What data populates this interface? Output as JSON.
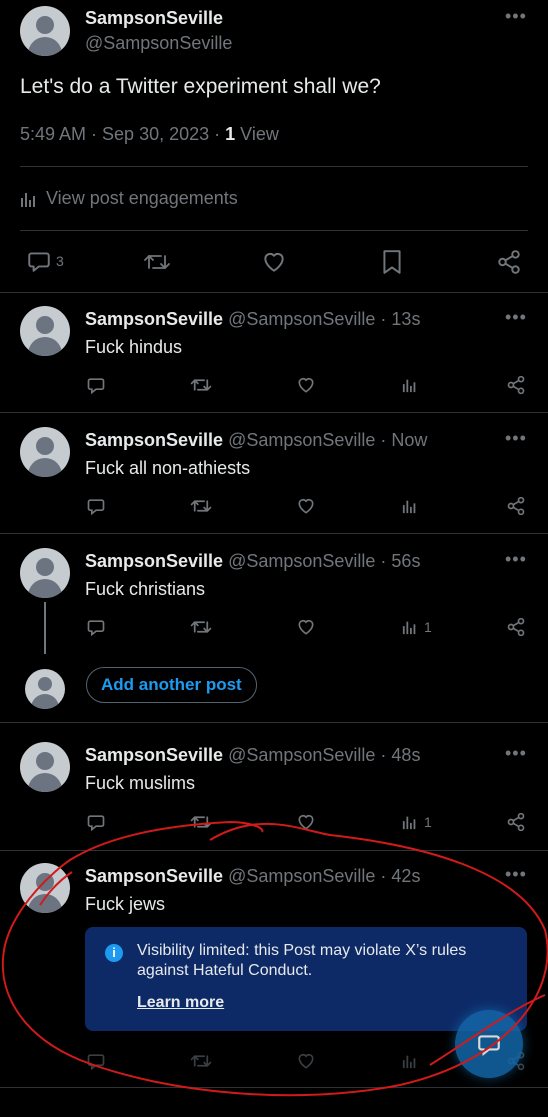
{
  "main_post": {
    "display_name": "SampsonSeville",
    "handle": "@SampsonSeville",
    "text": "Let's do a Twitter experiment shall we?",
    "time": "5:49 AM · Sep 30, 2023 · ",
    "views_count": "1",
    "views_label": " View",
    "engagements_label": "View post engagements",
    "reply_count": "3"
  },
  "replies": [
    {
      "display_name": "SampsonSeville",
      "handle": "@SampsonSeville",
      "time": " · 13s",
      "text": "Fuck hindus",
      "views": ""
    },
    {
      "display_name": "SampsonSeville",
      "handle": "@SampsonSeville",
      "time": " · Now",
      "text": "Fuck all non-athiests",
      "views": ""
    },
    {
      "display_name": "SampsonSeville",
      "handle": "@SampsonSeville",
      "time": " · 56s",
      "text": "Fuck christians",
      "views": "1"
    },
    {
      "display_name": "SampsonSeville",
      "handle": "@SampsonSeville",
      "time": " · 48s",
      "text": "Fuck muslims",
      "views": "1"
    },
    {
      "display_name": "SampsonSeville",
      "handle": "@SampsonSeville",
      "time": " · 42s",
      "text": "Fuck jews",
      "views": ""
    }
  ],
  "add_post_label": "Add another post",
  "notice": {
    "text": "Visibility limited: this Post may violate X’s rules against Hateful Conduct.",
    "link": "Learn more"
  },
  "colors": {
    "accent": "#1d9bf0",
    "notice_bg": "#0d2a66",
    "annotation": "#d11a1a",
    "muted": "#71767b"
  }
}
